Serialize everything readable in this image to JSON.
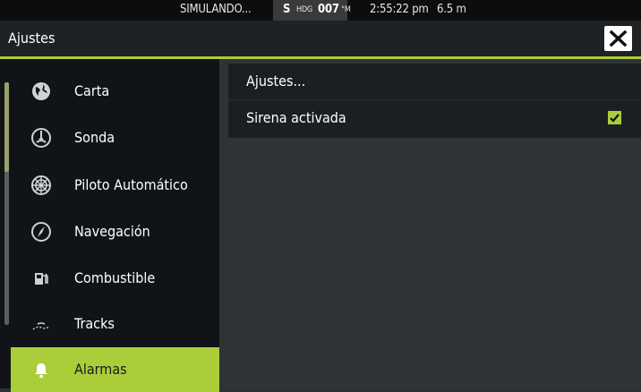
{
  "status_bar": {
    "simulating": "SIMULANDO...",
    "heading_prefix": "S",
    "heading_label": "HDG",
    "heading_value": "007",
    "heading_unit": "°M",
    "time": "2:55:22 pm",
    "depth": "6.5 m"
  },
  "header": {
    "title": "Ajustes",
    "close_icon": "close-icon"
  },
  "sidebar": {
    "items": [
      {
        "label": "Carta",
        "icon": "globe-icon"
      },
      {
        "label": "Sonda",
        "icon": "sonar-icon"
      },
      {
        "label": "Piloto Automático",
        "icon": "helm-wheel-icon"
      },
      {
        "label": "Navegación",
        "icon": "compass-icon"
      },
      {
        "label": "Combustible",
        "icon": "fuel-pump-icon"
      },
      {
        "label": "Tracks",
        "icon": "track-icon"
      },
      {
        "label": "Alarmas",
        "icon": "bell-icon",
        "selected": true
      }
    ]
  },
  "panel": {
    "rows": [
      {
        "label": "Ajustes..."
      },
      {
        "label": "Sirena activada",
        "checked": true
      }
    ]
  },
  "colors": {
    "accent": "#aacd3a",
    "sidebar_bg": "#111416",
    "content_bg": "#2e3335"
  }
}
